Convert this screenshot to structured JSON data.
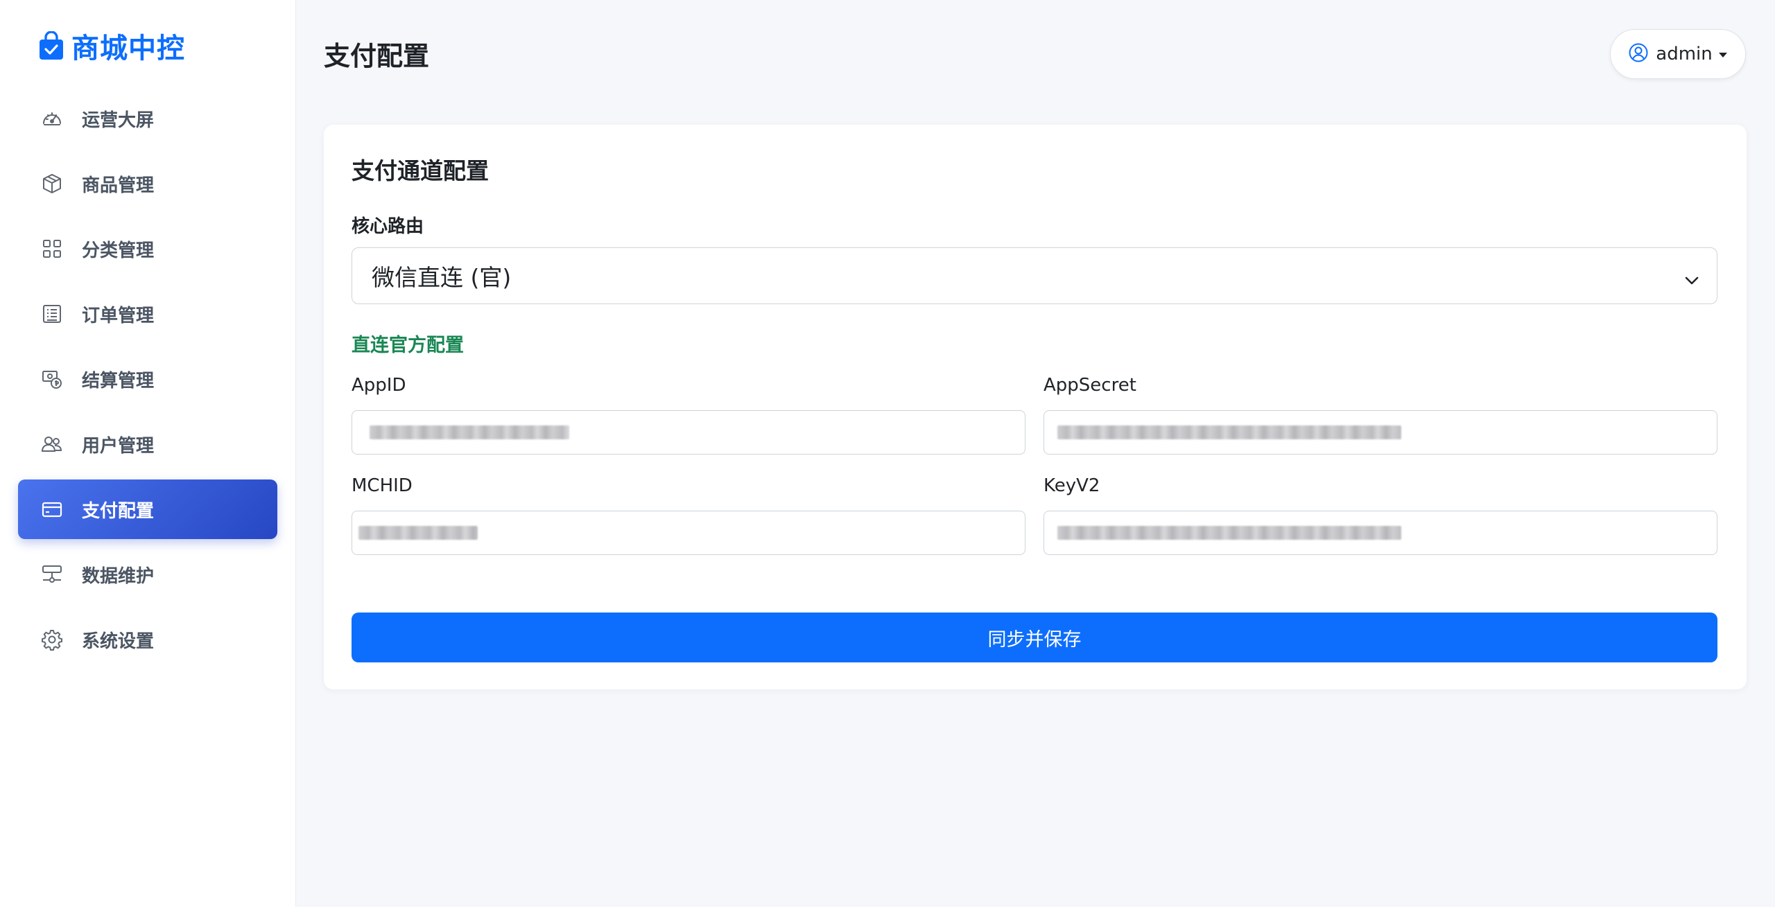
{
  "brand": {
    "name": "商城中控",
    "color": "#0d6efd",
    "icon": "shopping-bag-check-icon"
  },
  "sidebar": {
    "items": [
      {
        "label": "运营大屏",
        "icon": "speedometer-icon",
        "active": false
      },
      {
        "label": "商品管理",
        "icon": "box-icon",
        "active": false
      },
      {
        "label": "分类管理",
        "icon": "grid-icon",
        "active": false
      },
      {
        "label": "订单管理",
        "icon": "receipt-list-icon",
        "active": false
      },
      {
        "label": "结算管理",
        "icon": "cash-coin-icon",
        "active": false
      },
      {
        "label": "用户管理",
        "icon": "people-icon",
        "active": false
      },
      {
        "label": "支付配置",
        "icon": "credit-card-icon",
        "active": true
      },
      {
        "label": "数据维护",
        "icon": "server-maintenance-icon",
        "active": false
      },
      {
        "label": "系统设置",
        "icon": "gear-icon",
        "active": false
      }
    ],
    "active_gradient": [
      "#4a73ee",
      "#2747c4"
    ]
  },
  "header": {
    "title": "支付配置",
    "user": {
      "name": "admin",
      "icon": "person-circle-icon"
    }
  },
  "card": {
    "title": "支付通道配置",
    "route": {
      "label": "核心路由",
      "selected": "微信直连 (官)"
    },
    "official_config": {
      "subtitle": "直连官方配置",
      "subtitle_color": "#198754",
      "fields": {
        "appid": {
          "label": "AppID"
        },
        "appsecret": {
          "label": "AppSecret"
        },
        "mchid": {
          "label": "MCHID"
        },
        "keyv2": {
          "label": "KeyV2"
        }
      }
    },
    "save_label": "同步并保存",
    "save_color": "#0d6efd"
  }
}
